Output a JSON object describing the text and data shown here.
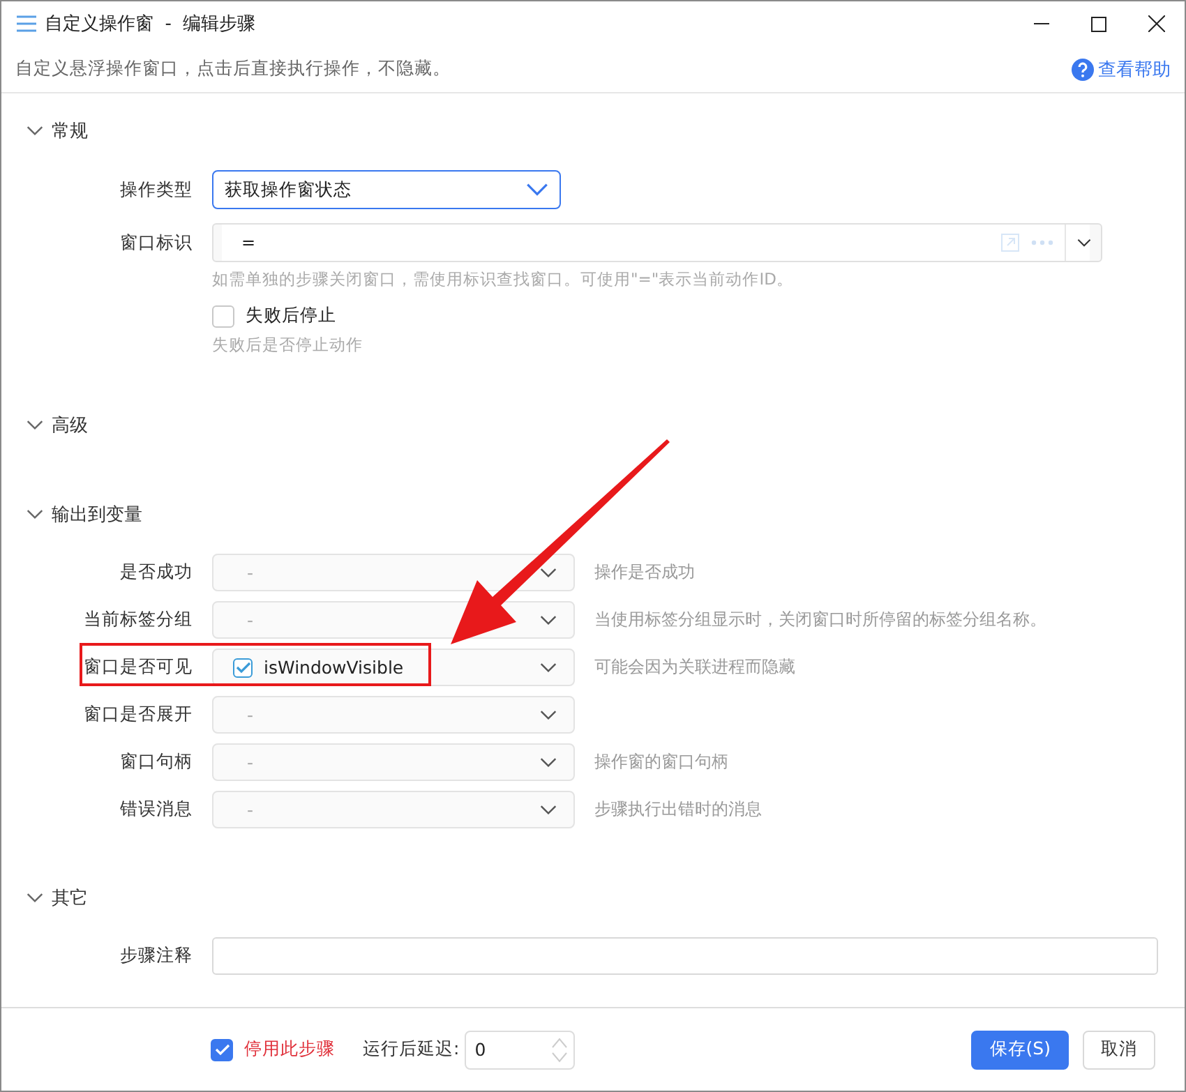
{
  "window": {
    "title": "自定义操作窗  -  编辑步骤"
  },
  "description": "自定义悬浮操作窗口，点击后直接执行操作，不隐藏。",
  "help_link": "查看帮助",
  "sections": [
    {
      "title": "常规",
      "rows": [
        {
          "kind": "select",
          "label": "操作类型",
          "value": "获取操作窗状态",
          "focused": true
        },
        {
          "kind": "combo",
          "label": "窗口标识",
          "value": "=",
          "hint": "如需单独的步骤关闭窗口，需使用标识查找窗口。可使用\"=\"表示当前动作ID。"
        },
        {
          "kind": "checkbox",
          "label": "失败后停止",
          "checked": false,
          "hint": "失败后是否停止动作"
        }
      ]
    },
    {
      "title": "高级"
    },
    {
      "title": "输出到变量",
      "rows": [
        {
          "kind": "output",
          "label": "是否成功",
          "placeholder": "-",
          "hint": "操作是否成功",
          "highlighted": false
        },
        {
          "kind": "output",
          "label": "当前标签分组",
          "placeholder": "-",
          "hint": "当使用标签分组显示时，关闭窗口时所停留的标签分组名称。",
          "highlighted": false
        },
        {
          "kind": "output",
          "label": "窗口是否可见",
          "value": "isWindowVisible",
          "checked": true,
          "hint": "可能会因为关联进程而隐藏",
          "highlighted": true
        },
        {
          "kind": "output",
          "label": "窗口是否展开",
          "placeholder": "-",
          "highlighted": false
        },
        {
          "kind": "output",
          "label": "窗口句柄",
          "placeholder": "-",
          "hint": "操作窗的窗口句柄",
          "highlighted": false
        },
        {
          "kind": "output",
          "label": "错误消息",
          "placeholder": "-",
          "hint": "步骤执行出错时的消息",
          "highlighted": false
        }
      ]
    },
    {
      "title": "其它",
      "rows": [
        {
          "kind": "text",
          "label": "步骤注释"
        }
      ]
    }
  ],
  "footer": {
    "disable_step": {
      "label": "停用此步骤",
      "checked": true
    },
    "delay": {
      "label": "运行后延迟:",
      "value": "0"
    },
    "buttons": [
      {
        "label": "保存(S)",
        "kind": "primary"
      },
      {
        "label": "取消",
        "kind": "default"
      }
    ]
  }
}
